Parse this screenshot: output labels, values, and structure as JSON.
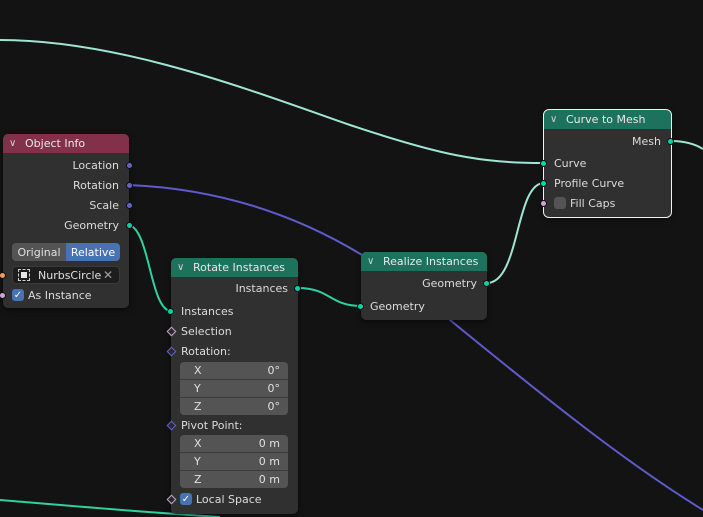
{
  "colors": {
    "background": "#131313",
    "node_body": "#303030",
    "header_input": "#83314a",
    "header_geometry": "#1d725e",
    "socket_geometry": "#00d6a3",
    "socket_vector": "#6363c7",
    "socket_object": "#ed9e5c",
    "socket_boolean": "#cca6d6",
    "link_selected": "#9ee6d2",
    "link_geometry": "#2ed1a0",
    "link_vector": "#5f5bcc",
    "accent": "#4772b3"
  },
  "nodes": {
    "object_info": {
      "title": "Object Info",
      "outputs": [
        "Location",
        "Rotation",
        "Scale",
        "Geometry"
      ],
      "transform_space": {
        "options": [
          "Original",
          "Relative"
        ],
        "selected": "Relative"
      },
      "object_field": {
        "value": "NurbsCircle",
        "icon": "object-icon",
        "clear_icon": "close-icon"
      },
      "as_instance": {
        "label": "As Instance",
        "checked": true
      }
    },
    "rotate_instances": {
      "title": "Rotate Instances",
      "output": "Instances",
      "inputs": {
        "instances": "Instances",
        "selection": "Selection",
        "rotation_label": "Rotation:",
        "rotation": [
          {
            "axis": "X",
            "value": "0°"
          },
          {
            "axis": "Y",
            "value": "0°"
          },
          {
            "axis": "Z",
            "value": "0°"
          }
        ],
        "pivot_label": "Pivot Point:",
        "pivot": [
          {
            "axis": "X",
            "value": "0 m"
          },
          {
            "axis": "Y",
            "value": "0 m"
          },
          {
            "axis": "Z",
            "value": "0 m"
          }
        ],
        "local_space": {
          "label": "Local Space",
          "checked": true
        }
      }
    },
    "realize_instances": {
      "title": "Realize Instances",
      "output": "Geometry",
      "input": "Geometry"
    },
    "curve_to_mesh": {
      "title": "Curve to Mesh",
      "output": "Mesh",
      "inputs": [
        "Curve",
        "Profile Curve"
      ],
      "fill_caps": {
        "label": "Fill Caps",
        "checked": false
      },
      "selected": true
    }
  }
}
